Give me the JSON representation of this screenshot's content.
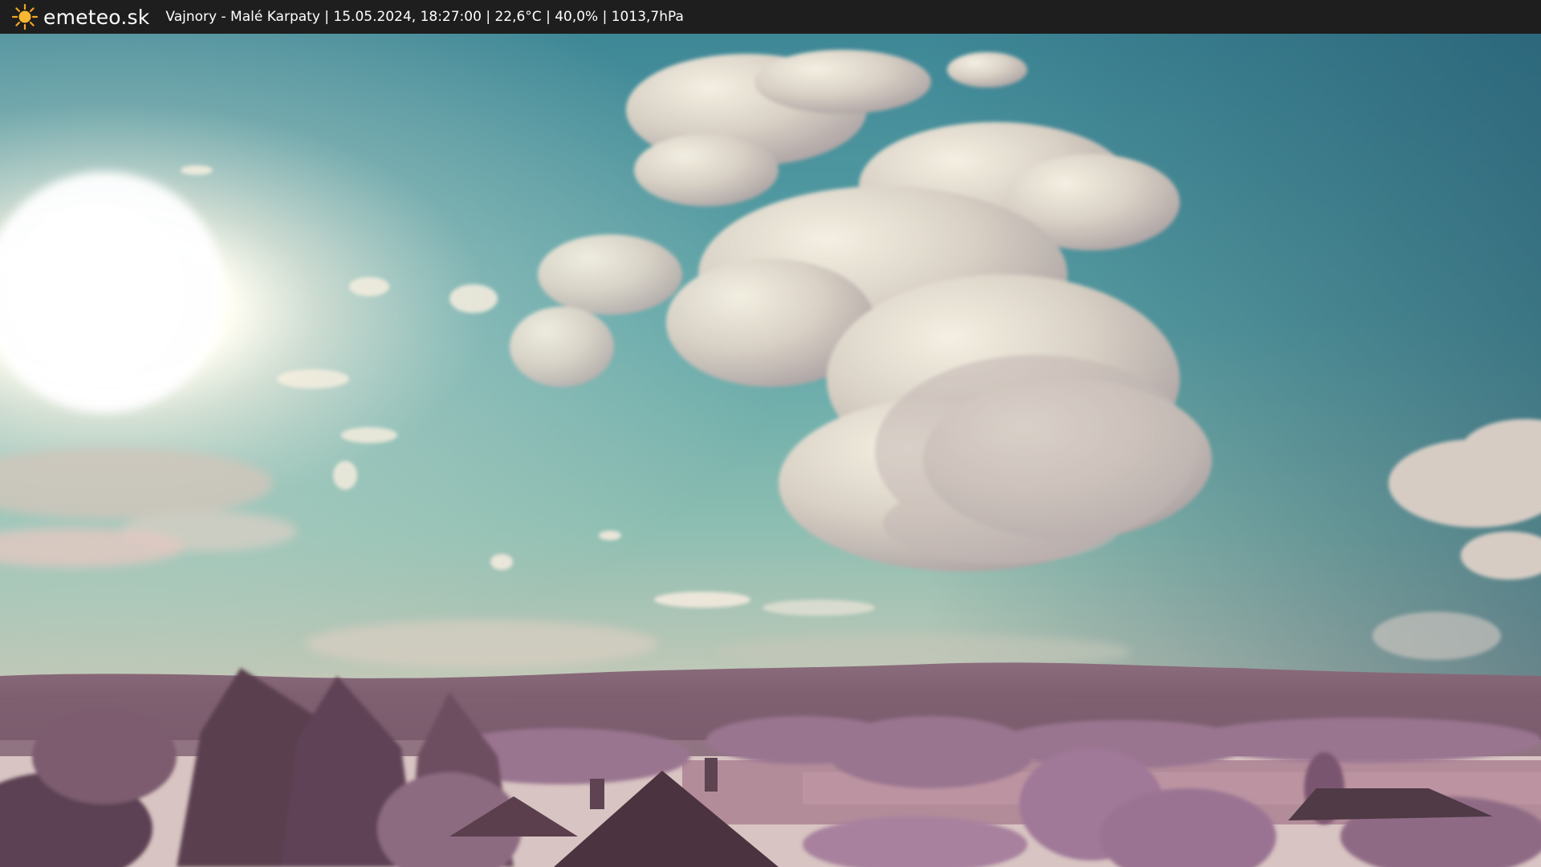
{
  "header": {
    "brand": "emeteo.sk",
    "brand_icon": "sun-icon",
    "station_info": "Vajnory - Malé Karpaty | 15.05.2024, 18:27:00 | 22,6°C | 40,0% | 1013,7hPa"
  },
  "colors": {
    "bar": "#1e1e1e",
    "sun_icon": "#f5a623",
    "sky_top": "#2f6b80",
    "sky_mid": "#5aa3a6",
    "sky_low": "#a7c6b6",
    "hills": "#7a5a6c",
    "foliage": "#a07898",
    "field": "#b08a96"
  }
}
